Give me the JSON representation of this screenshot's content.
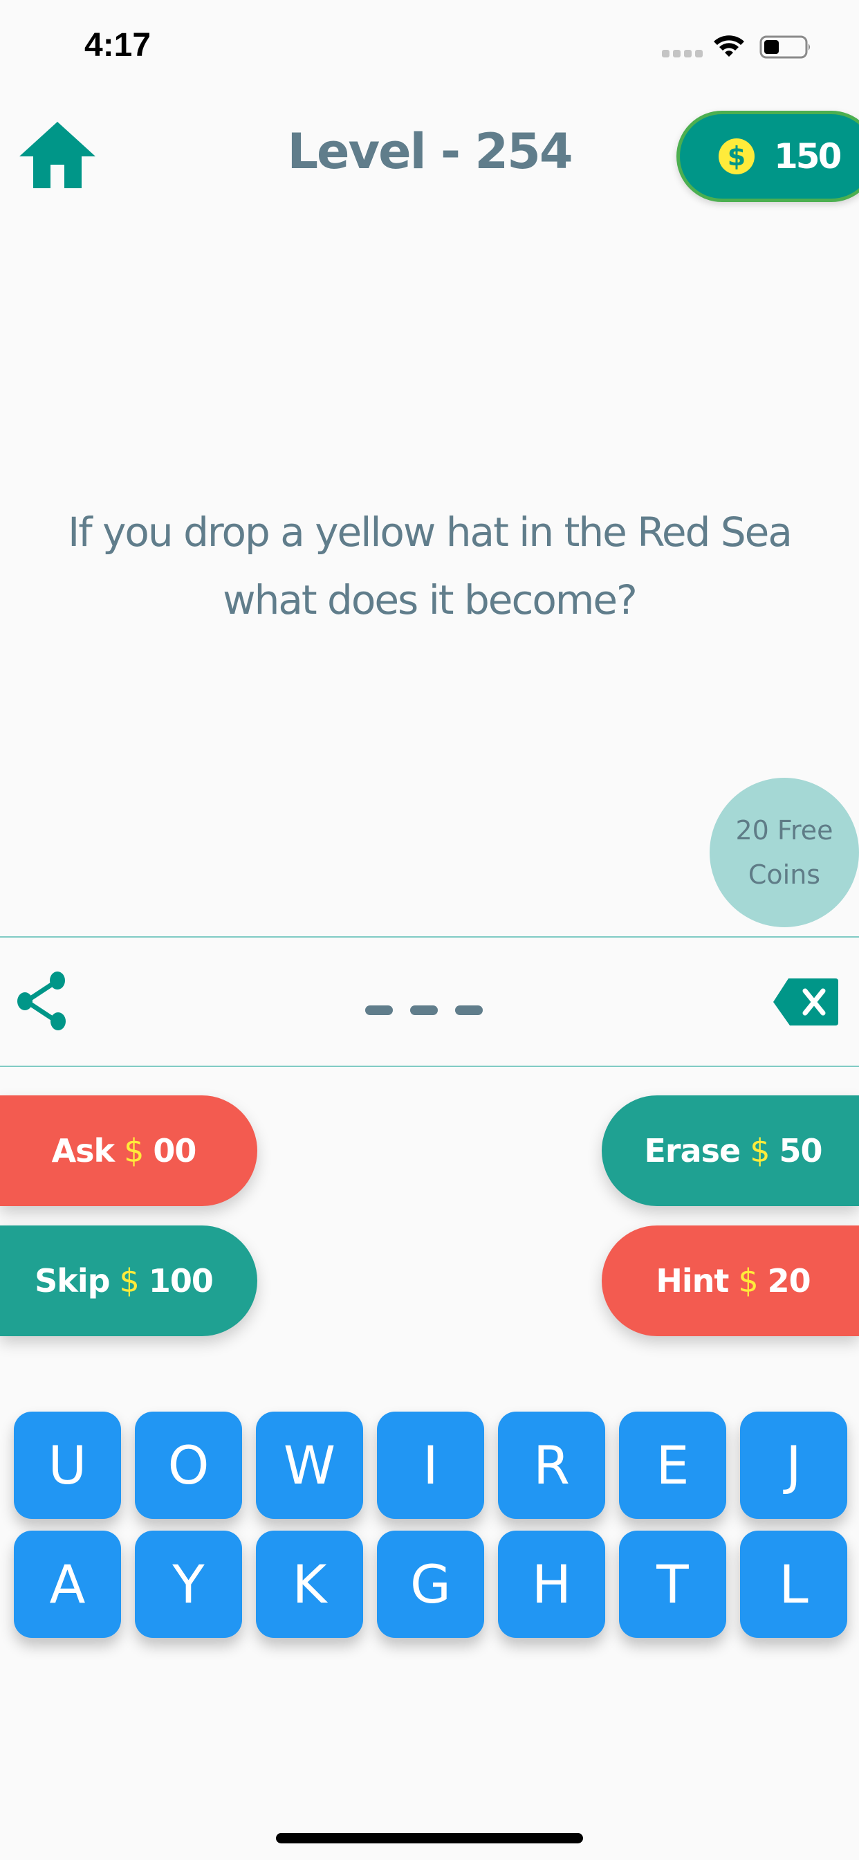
{
  "status_bar": {
    "time": "4:17",
    "icons": [
      "cellular-signal-icon",
      "wifi-icon",
      "battery-icon"
    ],
    "battery_level": 0.3
  },
  "header": {
    "home_icon": "home-icon",
    "title": "Level - 254",
    "coins": {
      "icon": "dollar-coin-icon",
      "symbol": "$",
      "count": "150"
    }
  },
  "question": {
    "text": "If you drop a yellow hat in the Red Sea what does it become?"
  },
  "free_coins": {
    "line1": "20 Free",
    "line2": "Coins"
  },
  "answer": {
    "share_icon": "share-icon",
    "slots": 3,
    "backspace_icon": "backspace-icon"
  },
  "actions": {
    "ask": {
      "label": "Ask",
      "symbol": "$",
      "cost": "00"
    },
    "skip": {
      "label": "Skip",
      "symbol": "$",
      "cost": "100"
    },
    "erase": {
      "label": "Erase",
      "symbol": "$",
      "cost": "50"
    },
    "hint": {
      "label": "Hint",
      "symbol": "$",
      "cost": "20"
    }
  },
  "keyboard": {
    "letters": [
      "U",
      "O",
      "W",
      "I",
      "R",
      "E",
      "J",
      "A",
      "Y",
      "K",
      "G",
      "H",
      "T",
      "L"
    ]
  },
  "colors": {
    "teal": "#009688",
    "teal_button": "#1fa192",
    "red_button": "#f35b50",
    "key_blue": "#2196f3",
    "coin_yellow": "#ffeb3b",
    "text_slate": "#607d8b",
    "pill_border": "#4caf50",
    "free_coins_bg": "#a5d8d5",
    "divider": "#80cbc4"
  }
}
